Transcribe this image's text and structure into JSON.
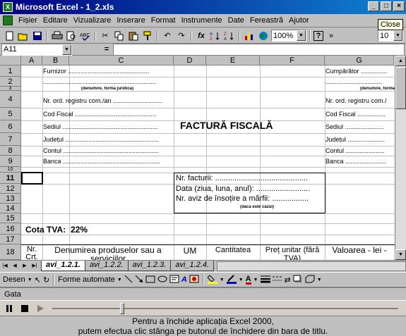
{
  "window": {
    "title": "Microsoft Excel - 1_2.xls",
    "close_tooltip": "Close",
    "buttons": [
      "_",
      "□",
      "×"
    ]
  },
  "menu": {
    "items": [
      "Fișier",
      "Editare",
      "Vizualizare",
      "Inserare",
      "Format",
      "Instrumente",
      "Date",
      "Fereastră",
      "Ajutor"
    ]
  },
  "toolbar": {
    "zoom": "100%",
    "font_size": "10",
    "icons": [
      "new-icon",
      "open-icon",
      "save-icon",
      "print-icon",
      "print-preview-icon",
      "spell-check-icon",
      "cut-icon",
      "copy-icon",
      "paste-icon",
      "format-painter-icon",
      "undo-icon",
      "redo-icon",
      "function-icon",
      "sort-ascending-icon",
      "sort-descending-icon",
      "chart-wizard-icon",
      "map-icon",
      "help-icon"
    ]
  },
  "formula_bar": {
    "name_box": "A11",
    "equals": "="
  },
  "columns": [
    "A",
    "B",
    "C",
    "D",
    "E",
    "F",
    "G"
  ],
  "rows": [
    "1",
    "2",
    "3",
    "4",
    "5",
    "6",
    "7",
    "8",
    "9",
    "10",
    "11",
    "12",
    "13",
    "14",
    "15",
    "16",
    "17",
    "18"
  ],
  "cells": {
    "furnizor": "Furnizor ..............................................",
    "furnizor_2": "................................................................",
    "denumire_left": "(denumire, formă juridică)",
    "nr_ord_left": "Nr. ord. registru com./an ............................",
    "cod_fiscal_left": "Cod Fiscal ..............................................",
    "sediul_left": "Sediul ......................................................",
    "judetul_left": "Județul .....................................................",
    "contul_left": "Contul ......................................................",
    "banca_left": "Banca .......................................................",
    "cumparator": "Cumpărător ...............",
    "cumparator_2": "................................",
    "denumire_right": "(denumire, formă",
    "nr_ord_right": "Nr. ord. registru com./",
    "cod_fiscal_right": "Cod Fiscal ................",
    "sediul_right": "Sediul ......................",
    "judetul_right": "Județul .....................",
    "contul_right": "Contul ......................",
    "banca_right": "Banca .......................",
    "invoice_title": "FACTURĂ FISCALĂ",
    "nr_facturii": "Nr. facturii: ...........................................",
    "data": "Data (ziua, luna, anul): .........................",
    "nr_aviz": "Nr. aviz de însoțire a mărfii: .................",
    "daca_este_cazul": "(dacă este cazul)",
    "cota_tva_label": "Cota TVA:",
    "cota_tva_value": "22%",
    "hdr_nr": "Nr. Crt.",
    "hdr_denumire": "Denumirea produselor sau a serviciilor",
    "hdr_um": "UM",
    "hdr_cantitatea": "Cantitatea",
    "hdr_pret": "Preț unitar (fără TVA)",
    "hdr_valoarea": "Valoarea - lei -"
  },
  "sheets": [
    "avi_1.2.1.",
    "avi_1.2.2.",
    "avi_1.2.3.",
    "avi_1.2.4."
  ],
  "drawing": {
    "desen": "Desen",
    "forme": "Forme automate"
  },
  "status": "Gata",
  "caption": {
    "line1": "Pentru a închide aplicația Excel 2000,",
    "line2": "putem efectua clic stânga pe butonul de închidere din bara de titlu."
  }
}
